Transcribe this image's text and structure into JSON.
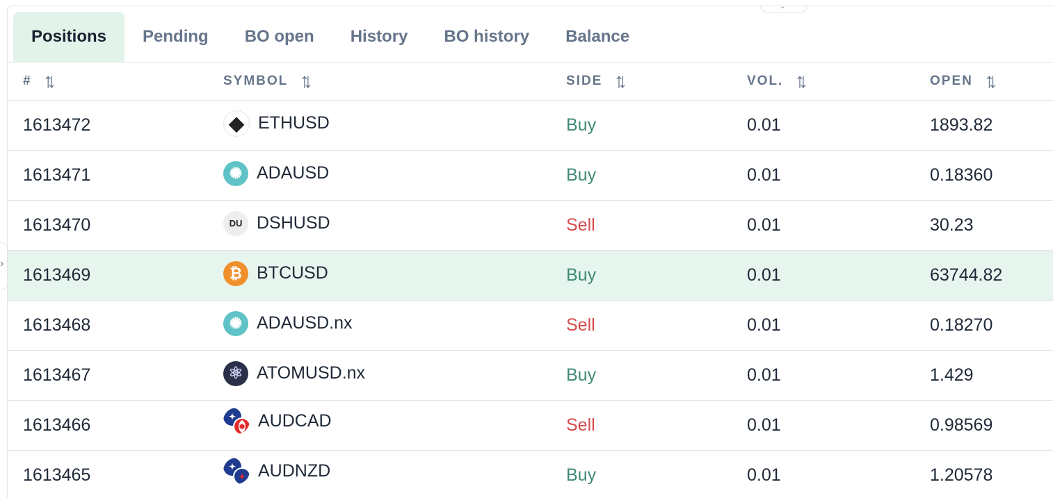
{
  "tabs": [
    {
      "label": "Positions",
      "active": true
    },
    {
      "label": "Pending"
    },
    {
      "label": "BO open"
    },
    {
      "label": "History"
    },
    {
      "label": "BO history"
    },
    {
      "label": "Balance"
    }
  ],
  "table": {
    "headers": [
      "#",
      "SYMBOL",
      "SIDE",
      "VOL.",
      "OPEN"
    ],
    "rows": [
      {
        "id": "1613472",
        "symbol": "ETHUSD",
        "icon": "ethereum-icon",
        "side": "Buy",
        "vol": "0.01",
        "open": "1893.82"
      },
      {
        "id": "1613471",
        "symbol": "ADAUSD",
        "icon": "cardano-icon",
        "side": "Buy",
        "vol": "0.01",
        "open": "0.18360"
      },
      {
        "id": "1613470",
        "symbol": "DSHUSD",
        "icon": "dsh-icon",
        "icon_text": "DU",
        "side": "Sell",
        "vol": "0.01",
        "open": "30.23"
      },
      {
        "id": "1613469",
        "symbol": "BTCUSD",
        "icon": "bitcoin-icon",
        "side": "Buy",
        "vol": "0.01",
        "open": "63744.82",
        "highlighted": true
      },
      {
        "id": "1613468",
        "symbol": "ADAUSD.nx",
        "icon": "cardano-icon",
        "side": "Sell",
        "vol": "0.01",
        "open": "0.18270"
      },
      {
        "id": "1613467",
        "symbol": "ATOMUSD.nx",
        "icon": "cosmos-atom-icon",
        "side": "Buy",
        "vol": "0.01",
        "open": "1.429"
      },
      {
        "id": "1613466",
        "symbol": "AUDCAD",
        "icon": "aud-cad-flags-icon",
        "side": "Sell",
        "vol": "0.01",
        "open": "0.98569"
      },
      {
        "id": "1613465",
        "symbol": "AUDNZD",
        "icon": "aud-nzd-flags-icon",
        "side": "Buy",
        "vol": "0.01",
        "open": "1.20578"
      }
    ]
  },
  "colors": {
    "buy": "#3d8a76",
    "sell": "#d64c4c",
    "active_tab_bg": "#e2f3ea",
    "highlight_row_bg": "#e6f5ee"
  }
}
